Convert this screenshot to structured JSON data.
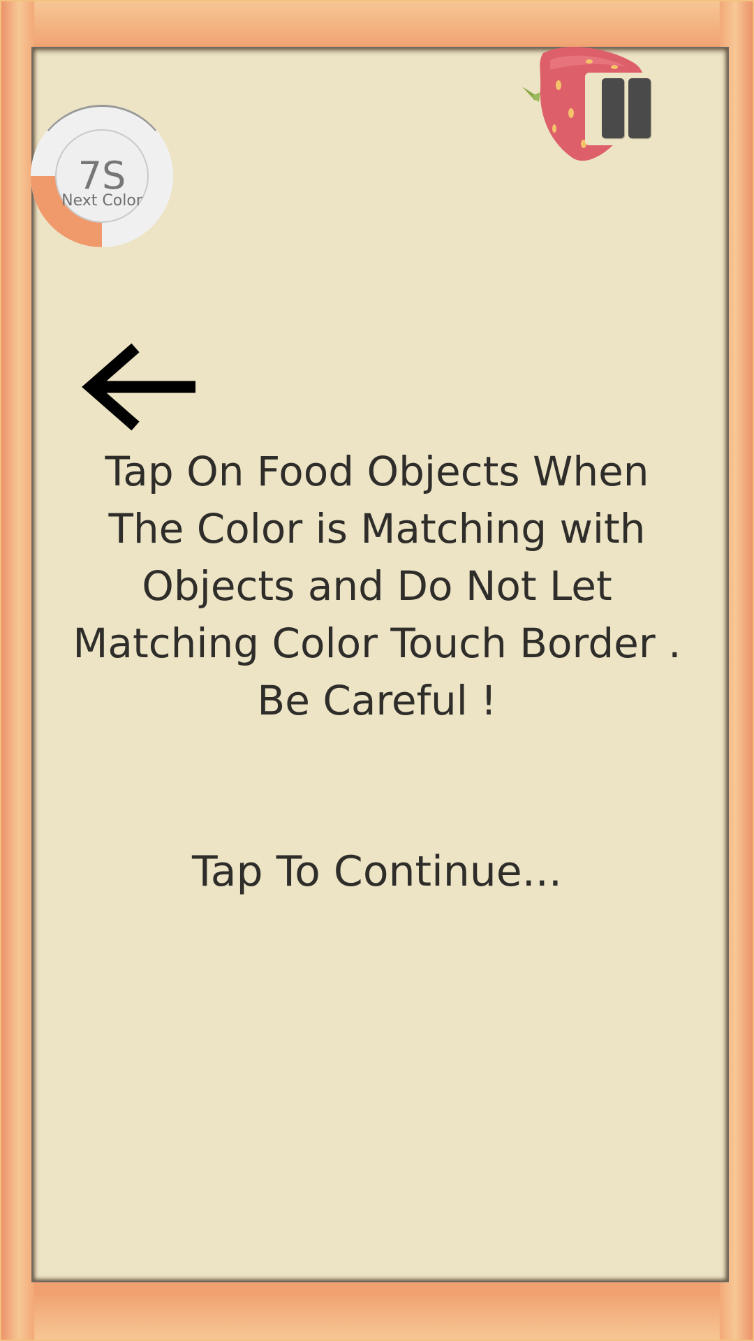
{
  "timer": {
    "value": "7S",
    "label": "Next Color",
    "remaining_fraction": 0.25,
    "progress_color": "#f0996a"
  },
  "controls": {
    "pause_icon": "pause-icon",
    "back_icon": "back-arrow-icon"
  },
  "decoration": {
    "fruit_icon": "strawberry-icon",
    "fruit_color": "#dc5f6a"
  },
  "instructions": {
    "text": "Tap On Food Objects When The Color is Matching with Objects and Do Not Let Matching Color Touch Border . Be Careful !"
  },
  "prompt": {
    "continue": "Tap To Continue..."
  },
  "colors": {
    "frame": "#f0a16f",
    "board": "#ede4c5",
    "text": "#2e2d2a"
  }
}
